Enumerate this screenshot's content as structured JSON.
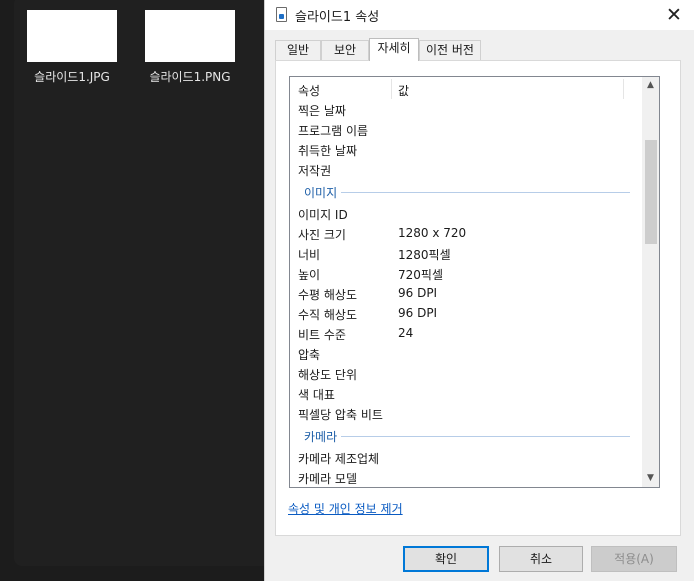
{
  "explorer": {
    "files": [
      {
        "name": "슬라이드1.JPG"
      },
      {
        "name": "슬라이드1.PNG"
      }
    ]
  },
  "dialog": {
    "title": "슬라이드1 속성",
    "close": "✕",
    "tabs": [
      "일반",
      "보안",
      "자세히",
      "이전 버전"
    ],
    "active_tab": "자세히",
    "columns": {
      "property": "속성",
      "value": "값"
    },
    "rows_top": [
      {
        "k": "찍은 날짜",
        "v": ""
      },
      {
        "k": "프로그램 이름",
        "v": ""
      },
      {
        "k": "취득한 날짜",
        "v": ""
      },
      {
        "k": "저작권",
        "v": ""
      }
    ],
    "group_image": "이미지",
    "rows_image": [
      {
        "k": "이미지 ID",
        "v": ""
      },
      {
        "k": "사진 크기",
        "v": "1280 x 720"
      },
      {
        "k": "너비",
        "v": "1280픽셀"
      },
      {
        "k": "높이",
        "v": "720픽셀"
      },
      {
        "k": "수평 해상도",
        "v": "96 DPI"
      },
      {
        "k": "수직 해상도",
        "v": "96 DPI"
      },
      {
        "k": "비트 수준",
        "v": "24"
      },
      {
        "k": "압축",
        "v": ""
      },
      {
        "k": "해상도 단위",
        "v": ""
      },
      {
        "k": "색 대표",
        "v": ""
      },
      {
        "k": "픽셀당 압축 비트",
        "v": ""
      }
    ],
    "group_camera": "카메라",
    "rows_camera": [
      {
        "k": "카메라 제조업체",
        "v": ""
      },
      {
        "k": "카메라 모델",
        "v": ""
      }
    ],
    "scroll_up": "▲",
    "scroll_down": "▼",
    "remove_link": "속성 및 개인 정보 제거",
    "buttons": {
      "ok": "확인",
      "cancel": "취소",
      "apply": "적용(A)"
    }
  }
}
